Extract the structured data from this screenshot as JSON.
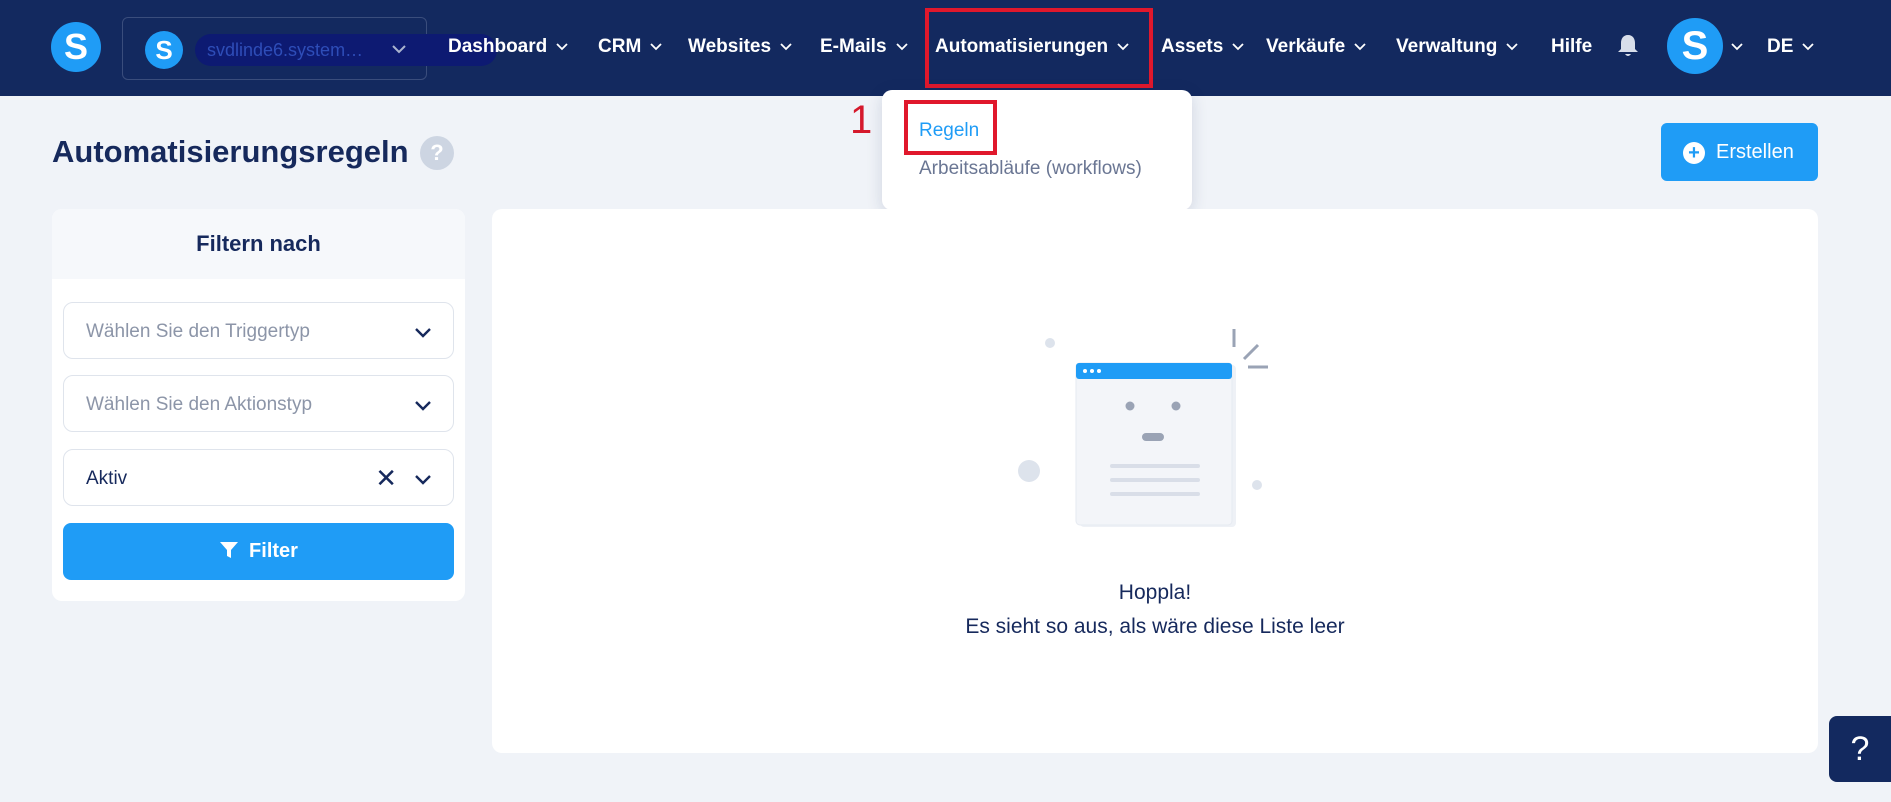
{
  "app": {
    "logo_letter": "S",
    "account_letter": "S",
    "account_name": "svdlinde6.system…",
    "user_letter": "S",
    "language": "DE"
  },
  "nav": {
    "items": [
      {
        "label": "Dashboard",
        "has_dropdown": true
      },
      {
        "label": "CRM",
        "has_dropdown": true
      },
      {
        "label": "Websites",
        "has_dropdown": true
      },
      {
        "label": "E-Mails",
        "has_dropdown": true
      },
      {
        "label": "Automatisierungen",
        "has_dropdown": true,
        "active": true
      },
      {
        "label": "Assets",
        "has_dropdown": true
      },
      {
        "label": "Verkäufe",
        "has_dropdown": true
      },
      {
        "label": "Verwaltung",
        "has_dropdown": true
      },
      {
        "label": "Hilfe",
        "has_dropdown": false
      }
    ]
  },
  "dropdown": {
    "items": [
      {
        "label": "Regeln",
        "highlighted": true
      },
      {
        "label": "Arbeitsabläufe (workflows)",
        "highlighted": false
      }
    ],
    "annotation_number": "1"
  },
  "page": {
    "title": "Automatisierungsregeln",
    "help_symbol": "?",
    "create_label": "Erstellen",
    "create_icon": "+"
  },
  "filter": {
    "heading": "Filtern nach",
    "trigger_placeholder": "Wählen Sie den Triggertyp",
    "action_placeholder": "Wählen Sie den Aktionstyp",
    "status_value": "Aktiv",
    "clear_symbol": "✕",
    "button_label": "Filter"
  },
  "empty_state": {
    "title": "Hoppla!",
    "message": "Es sieht so aus, als wäre diese Liste leer"
  },
  "floating_help": "?",
  "colors": {
    "topbar": "#13295f",
    "accent": "#1f9cf6",
    "highlight": "#e0182c",
    "background": "#f0f3f8"
  }
}
